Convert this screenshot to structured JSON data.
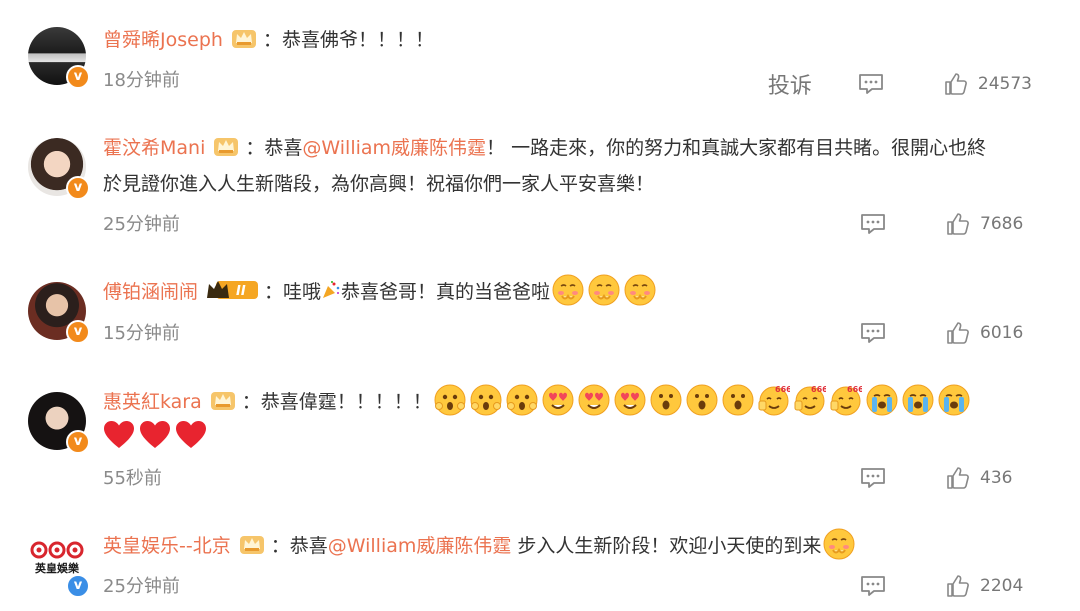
{
  "comments": [
    {
      "username": "曾舜晞Joseph",
      "separator": "：",
      "text": "恭喜佛爷！！！！",
      "time": "18分钟前",
      "report_label": "投诉",
      "likes": "24573",
      "verified": "orange"
    },
    {
      "username": "霍汶希Mani",
      "separator": "：",
      "text_before": "恭喜",
      "mention": "@William威廉陈伟霆",
      "text_after": "！ 一路走來，你的努力和真誠大家都有目共睹。很開心也終",
      "line2": "於見證你進入人生新階段，為你高興！祝福你們一家人平安喜樂！",
      "time": "25分钟前",
      "likes": "7686",
      "verified": "orange"
    },
    {
      "username": "傅铂涵闹闹",
      "level_badge": "II",
      "separator": "：",
      "text_a": "哇哦",
      "text_b": "恭喜爸哥！真的当爸爸啦",
      "time": "15分钟前",
      "likes": "6016",
      "verified": "orange"
    },
    {
      "username": "惠英紅kara",
      "separator": "：",
      "text": "恭喜偉霆！！！！！",
      "time": "55秒前",
      "likes": "436",
      "verified": "orange"
    },
    {
      "username": "英皇娱乐--北京",
      "separator": "：",
      "text_before": "恭喜",
      "mention": "@William威廉陈伟霆",
      "text_after": " 步入人生新阶段！欢迎小天使的到来",
      "avatar_logo_text": "英皇娛樂",
      "time": "25分钟前",
      "likes": "2204",
      "verified": "blue"
    }
  ],
  "icons": {
    "comment": "comment-icon",
    "like": "thumbs-up-icon",
    "crown": "crown-badge-icon"
  },
  "colors": {
    "username": "#eb7350",
    "time": "#8a8a8a",
    "verified_orange": "#f28a1b",
    "verified_blue": "#3a8ee6"
  }
}
